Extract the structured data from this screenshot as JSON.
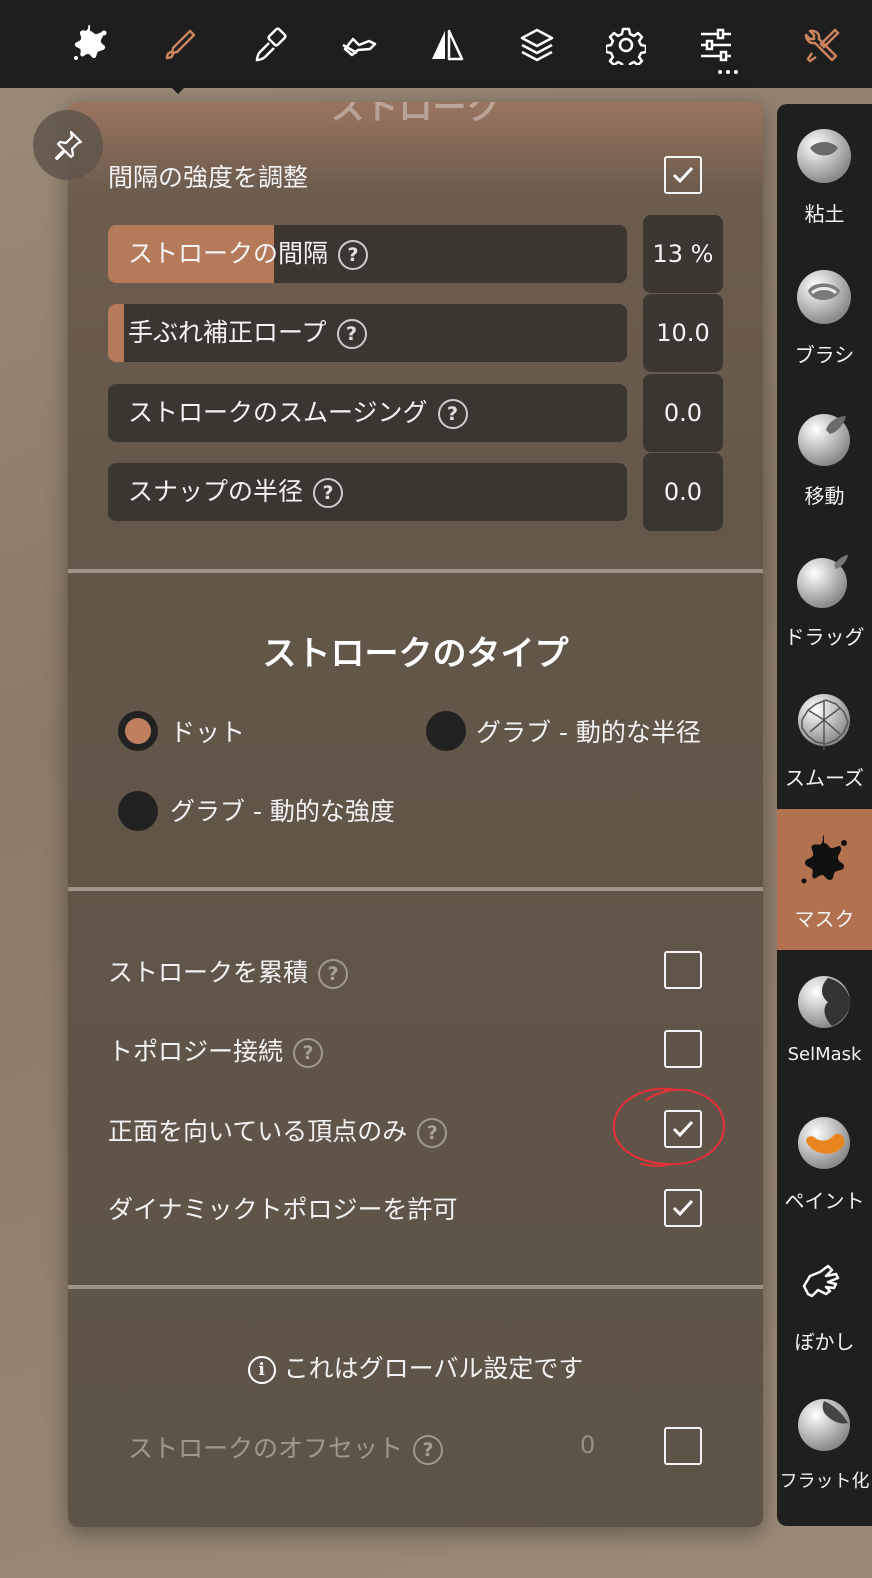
{
  "toolbar": {
    "icons": [
      "splat-icon",
      "brush-icon",
      "paint-brush-icon",
      "hand-pose-icon",
      "symmetry-icon",
      "layers-icon",
      "settings-icon",
      "sliders-icon",
      "tools-icon"
    ],
    "accent": "#c9835d"
  },
  "panel": {
    "title_partial": "ストローク",
    "adjust_intensity_label": "間隔の強度を調整",
    "adjust_intensity_checked": true,
    "sliders": [
      {
        "label": "ストロークの間隔",
        "value": "13 %",
        "fill_fraction": 0.32
      },
      {
        "label": "手ぶれ補正ロープ",
        "value": "10.0",
        "fill_fraction": 0.03
      },
      {
        "label": "ストロークのスムージング",
        "value": "0.0",
        "fill_fraction": 0
      },
      {
        "label": "スナップの半径",
        "value": "0.0",
        "fill_fraction": 0
      }
    ],
    "help_glyph": "?",
    "stroke_type": {
      "title": "ストロークのタイプ",
      "options": [
        {
          "label": "ドット",
          "selected": true
        },
        {
          "label": "グラブ - 動的な半径",
          "selected": false
        },
        {
          "label": "グラブ - 動的な強度",
          "selected": false
        }
      ]
    },
    "options": [
      {
        "label": "ストロークを累積",
        "help": true,
        "checked": false
      },
      {
        "label": "トポロジー接続",
        "help": true,
        "checked": false
      },
      {
        "label": "正面を向いている頂点のみ",
        "help": true,
        "checked": true
      },
      {
        "label": "ダイナミックトポロジーを許可",
        "help": false,
        "checked": true
      }
    ],
    "global_note_icon": "i",
    "global_note": "これはグローバル設定です",
    "offset": {
      "label": "ストロークのオフセット",
      "value": "0",
      "checked": false
    }
  },
  "sidebar": {
    "tools": [
      {
        "label": "粘土",
        "icon": "clay-sphere-icon",
        "active": false
      },
      {
        "label": "ブラシ",
        "icon": "brush-sphere-icon",
        "active": false
      },
      {
        "label": "移動",
        "icon": "move-sphere-icon",
        "active": false
      },
      {
        "label": "ドラッグ",
        "icon": "drag-sphere-icon",
        "active": false
      },
      {
        "label": "スムーズ",
        "icon": "smooth-sphere-icon",
        "active": false
      },
      {
        "label": "マスク",
        "icon": "mask-splat-icon",
        "active": true
      },
      {
        "label": "SelMask",
        "icon": "selmask-sphere-icon",
        "active": false
      },
      {
        "label": "ペイント",
        "icon": "paint-sphere-icon",
        "active": false
      },
      {
        "label": "ぼかし",
        "icon": "smudge-finger-icon",
        "active": false
      },
      {
        "label": "フラット化",
        "icon": "flatten-sphere-icon",
        "active": false
      }
    ]
  },
  "colors": {
    "active_tool": "#b27250",
    "slider_fill": "#b57a5a",
    "annotation": "#e0303a"
  }
}
